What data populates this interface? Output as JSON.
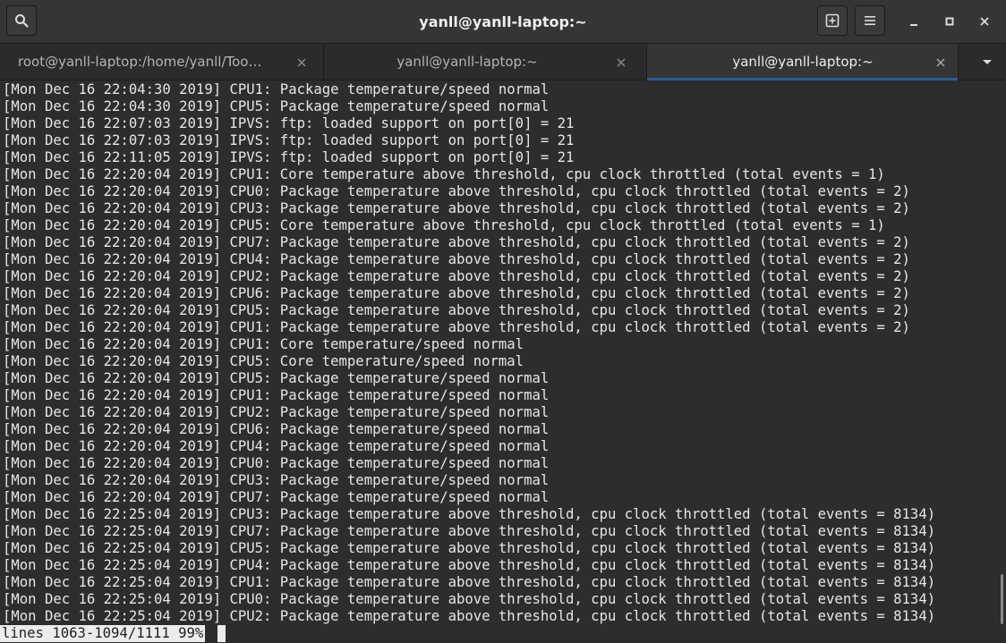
{
  "window": {
    "title": "yanll@yanll-laptop:~"
  },
  "tabs": [
    {
      "label": "root@yanll-laptop:/home/yanll/Too…",
      "active": false
    },
    {
      "label": "yanll@yanll-laptop:~",
      "active": false
    },
    {
      "label": "yanll@yanll-laptop:~",
      "active": true
    }
  ],
  "terminal": {
    "lines": [
      "[Mon Dec 16 22:04:30 2019] CPU1: Package temperature/speed normal",
      "[Mon Dec 16 22:04:30 2019] CPU5: Package temperature/speed normal",
      "[Mon Dec 16 22:07:03 2019] IPVS: ftp: loaded support on port[0] = 21",
      "[Mon Dec 16 22:07:03 2019] IPVS: ftp: loaded support on port[0] = 21",
      "[Mon Dec 16 22:11:05 2019] IPVS: ftp: loaded support on port[0] = 21",
      "[Mon Dec 16 22:20:04 2019] CPU1: Core temperature above threshold, cpu clock throttled (total events = 1)",
      "[Mon Dec 16 22:20:04 2019] CPU0: Package temperature above threshold, cpu clock throttled (total events = 2)",
      "[Mon Dec 16 22:20:04 2019] CPU3: Package temperature above threshold, cpu clock throttled (total events = 2)",
      "[Mon Dec 16 22:20:04 2019] CPU5: Core temperature above threshold, cpu clock throttled (total events = 1)",
      "[Mon Dec 16 22:20:04 2019] CPU7: Package temperature above threshold, cpu clock throttled (total events = 2)",
      "[Mon Dec 16 22:20:04 2019] CPU4: Package temperature above threshold, cpu clock throttled (total events = 2)",
      "[Mon Dec 16 22:20:04 2019] CPU2: Package temperature above threshold, cpu clock throttled (total events = 2)",
      "[Mon Dec 16 22:20:04 2019] CPU6: Package temperature above threshold, cpu clock throttled (total events = 2)",
      "[Mon Dec 16 22:20:04 2019] CPU5: Package temperature above threshold, cpu clock throttled (total events = 2)",
      "[Mon Dec 16 22:20:04 2019] CPU1: Package temperature above threshold, cpu clock throttled (total events = 2)",
      "[Mon Dec 16 22:20:04 2019] CPU1: Core temperature/speed normal",
      "[Mon Dec 16 22:20:04 2019] CPU5: Core temperature/speed normal",
      "[Mon Dec 16 22:20:04 2019] CPU5: Package temperature/speed normal",
      "[Mon Dec 16 22:20:04 2019] CPU1: Package temperature/speed normal",
      "[Mon Dec 16 22:20:04 2019] CPU2: Package temperature/speed normal",
      "[Mon Dec 16 22:20:04 2019] CPU6: Package temperature/speed normal",
      "[Mon Dec 16 22:20:04 2019] CPU4: Package temperature/speed normal",
      "[Mon Dec 16 22:20:04 2019] CPU0: Package temperature/speed normal",
      "[Mon Dec 16 22:20:04 2019] CPU3: Package temperature/speed normal",
      "[Mon Dec 16 22:20:04 2019] CPU7: Package temperature/speed normal",
      "[Mon Dec 16 22:25:04 2019] CPU3: Package temperature above threshold, cpu clock throttled (total events = 8134)",
      "[Mon Dec 16 22:25:04 2019] CPU7: Package temperature above threshold, cpu clock throttled (total events = 8134)",
      "[Mon Dec 16 22:25:04 2019] CPU5: Package temperature above threshold, cpu clock throttled (total events = 8134)",
      "[Mon Dec 16 22:25:04 2019] CPU4: Package temperature above threshold, cpu clock throttled (total events = 8134)",
      "[Mon Dec 16 22:25:04 2019] CPU1: Package temperature above threshold, cpu clock throttled (total events = 8134)",
      "[Mon Dec 16 22:25:04 2019] CPU0: Package temperature above threshold, cpu clock throttled (total events = 8134)",
      "[Mon Dec 16 22:25:04 2019] CPU2: Package temperature above threshold, cpu clock throttled (total events = 8134)"
    ],
    "status": "lines 1063-1094/1111 99%"
  },
  "icons": {
    "search": "search-icon",
    "new_tab": "new-tab-icon",
    "menu": "hamburger-menu-icon",
    "minimize": "minimize-icon",
    "maximize": "maximize-icon",
    "close": "close-icon",
    "tab_close": "tab-close-icon",
    "tab_overflow": "chevron-down-icon"
  },
  "colors": {
    "background": "#2d2d2d",
    "accent": "#215d9c",
    "text": "#e6e6e6"
  }
}
